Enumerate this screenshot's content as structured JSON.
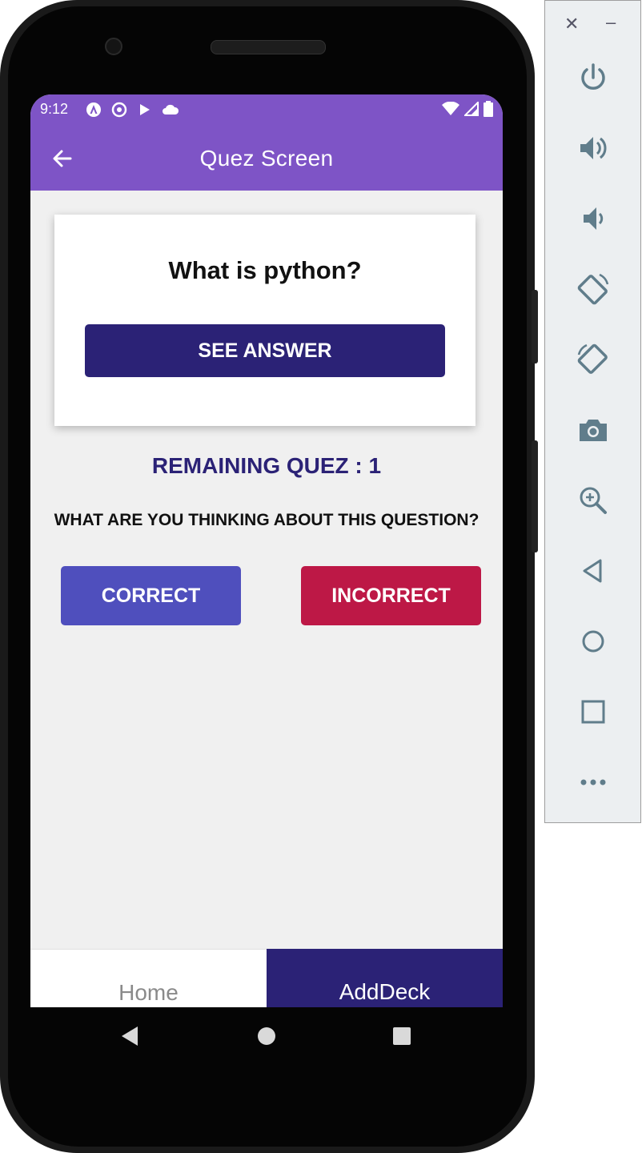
{
  "status_bar": {
    "time": "9:12"
  },
  "app_bar": {
    "title": "Quez Screen"
  },
  "card": {
    "question": "What is python?",
    "see_answer_label": "SEE ANSWER"
  },
  "remaining_text": "REMAINING QUEZ : 1",
  "prompt_text": "WHAT ARE YOU THINKING ABOUT THIS QUESTION?",
  "buttons": {
    "correct_label": "CORRECT",
    "incorrect_label": "INCORRECT"
  },
  "tabs": [
    {
      "label": "Home",
      "active": false
    },
    {
      "label": "AddDeck",
      "active": true
    }
  ],
  "colors": {
    "header": "#7e54c6",
    "primary": "#2b2276",
    "correct": "#4f4fbd",
    "incorrect": "#bd1846"
  },
  "emulator_panel": {
    "icons": [
      "close-icon",
      "minimize-icon",
      "power-icon",
      "volume-up-icon",
      "volume-down-icon",
      "rotate-left-icon",
      "rotate-right-icon",
      "camera-icon",
      "zoom-icon",
      "back-icon",
      "home-icon",
      "overview-icon",
      "more-icon"
    ]
  }
}
